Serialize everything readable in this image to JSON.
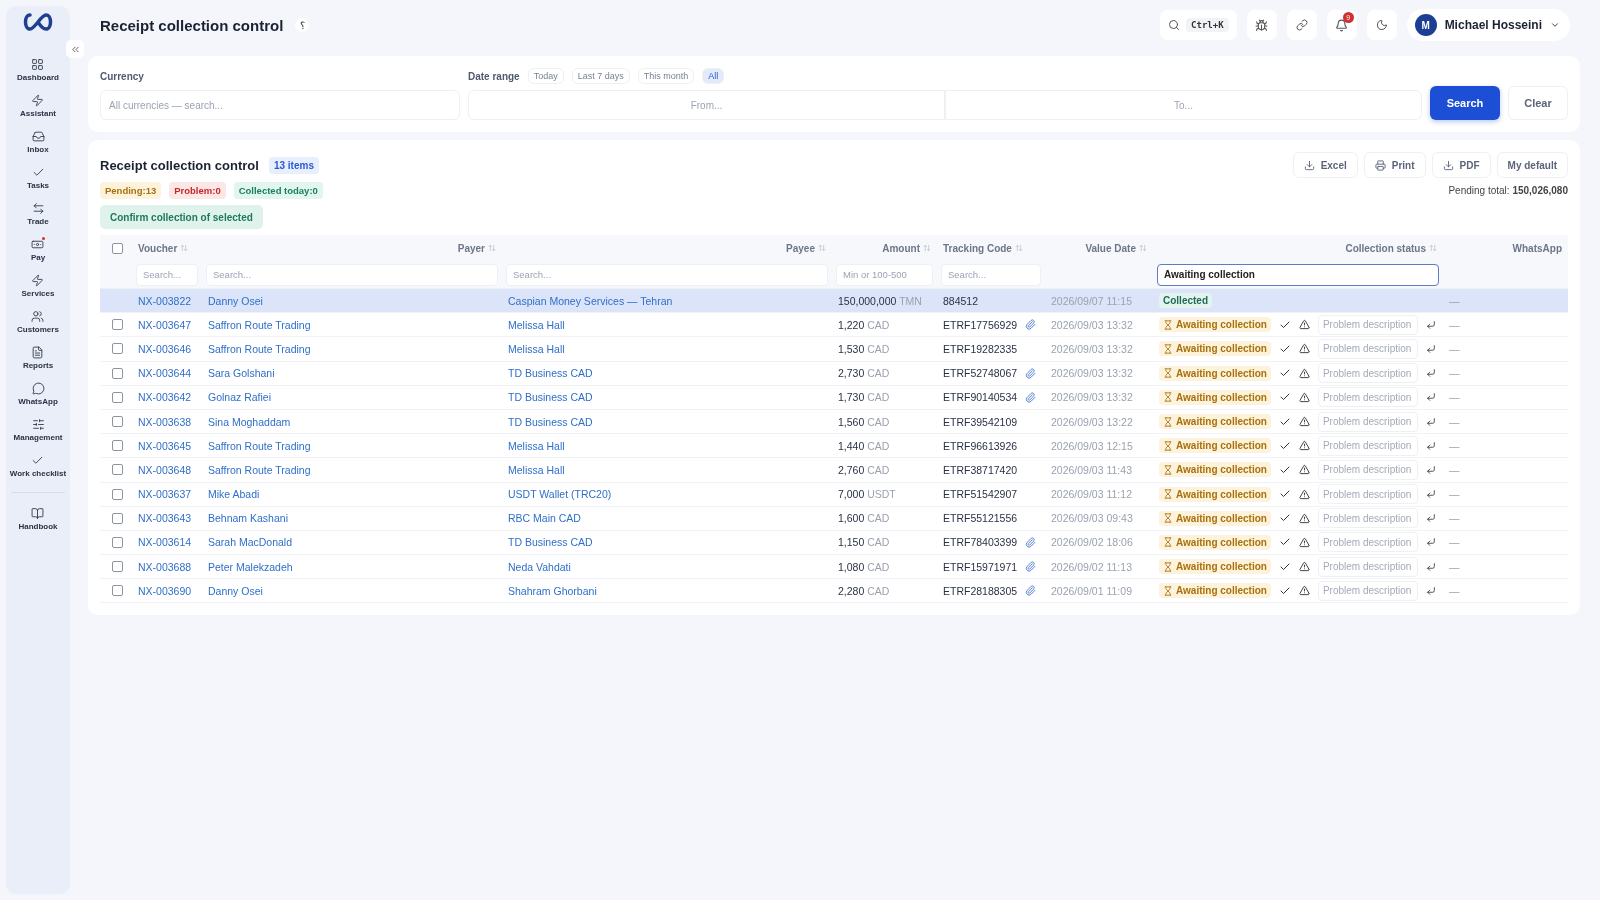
{
  "sidebar": {
    "items": [
      {
        "label": "Dashboard",
        "notify": false
      },
      {
        "label": "Assistant",
        "notify": false
      },
      {
        "label": "Inbox",
        "notify": false
      },
      {
        "label": "Tasks",
        "notify": false
      },
      {
        "label": "Trade",
        "notify": false
      },
      {
        "label": "Pay",
        "notify": true
      },
      {
        "label": "Services",
        "notify": false
      },
      {
        "label": "Customers",
        "notify": false
      },
      {
        "label": "Reports",
        "notify": false
      },
      {
        "label": "WhatsApp",
        "notify": false
      },
      {
        "label": "Management",
        "notify": false
      },
      {
        "label": "Work checklist",
        "notify": false
      },
      {
        "label": "Handbook",
        "notify": false
      }
    ]
  },
  "header": {
    "title": "Receipt collection control",
    "title_mark": "؟",
    "shortcut": "Ctrl+K",
    "notification_count": "9",
    "user_initial": "M",
    "user_name": "Michael Hosseini"
  },
  "filters": {
    "currency": {
      "label": "Currency",
      "placeholder": "All currencies — search..."
    },
    "date_range": {
      "label": "Date range",
      "presets": [
        {
          "label": "Today",
          "selected": false
        },
        {
          "label": "Last 7 days",
          "selected": false
        },
        {
          "label": "This month",
          "selected": false
        },
        {
          "label": "All",
          "selected": true
        }
      ],
      "from_placeholder": "From...",
      "to_placeholder": "To..."
    },
    "buttons": [
      "Search",
      "Clear"
    ]
  },
  "panel": {
    "title": "Receipt collection control",
    "count": "13 items",
    "stats": [
      {
        "kind": "pending",
        "label": "Pending:13"
      },
      {
        "kind": "problem",
        "label": "Problem:0"
      },
      {
        "kind": "collected",
        "label": "Collected today:0"
      }
    ],
    "confirm_button": "Confirm collection of selected",
    "actions": [
      {
        "kind": "download",
        "label": "Excel"
      },
      {
        "kind": "print",
        "label": "Print"
      },
      {
        "kind": "download",
        "label": "PDF"
      },
      {
        "kind": "plain",
        "label": "My default"
      }
    ],
    "total_label": "Pending total:",
    "total_value": "150,026,080"
  },
  "table": {
    "select_all_checked": false,
    "columns": [
      {
        "label": "Voucher",
        "sortable": true
      },
      {
        "label": "Payer",
        "sortable": true
      },
      {
        "label": "Payee",
        "sortable": true
      },
      {
        "label": "Amount",
        "sortable": true
      },
      {
        "label": "Tracking Code",
        "sortable": true
      },
      {
        "label": "Value Date",
        "sortable": true
      },
      {
        "label": "Collection status",
        "sortable": true
      },
      {
        "label": "WhatsApp",
        "sortable": false
      }
    ],
    "filter_row": {
      "voucher": {
        "placeholder": "Search..."
      },
      "payer": {
        "placeholder": "Search..."
      },
      "payee": {
        "placeholder": "Search..."
      },
      "amount": {
        "placeholder": "Min or 100-500"
      },
      "tracking": {
        "placeholder": "Search..."
      },
      "status": {
        "value": "Awaiting collection"
      }
    },
    "rows": [
      {
        "selected": true,
        "voucher": "NX-003822",
        "payer": "Danny Osei",
        "payee": "Caspian Money Services — Tehran",
        "amount": "150,000,000",
        "currency": "TMN",
        "tracking": "884512",
        "attachment": false,
        "date": "2026/09/07 11:15",
        "status": {
          "kind": "collected",
          "label": "Collected"
        },
        "whatsapp": "—"
      },
      {
        "selected": false,
        "checked": false,
        "voucher": "NX-003647",
        "payer": "Saffron Route Trading",
        "payee": "Melissa Hall",
        "amount": "1,220",
        "currency": "CAD",
        "tracking": "ETRF17756929",
        "attachment": true,
        "date": "2026/09/03 13:32",
        "status": {
          "kind": "awaiting",
          "label": "Awaiting collection",
          "problem_placeholder": "Problem description"
        },
        "whatsapp": "—"
      },
      {
        "selected": false,
        "checked": false,
        "voucher": "NX-003646",
        "payer": "Saffron Route Trading",
        "payee": "Melissa Hall",
        "amount": "1,530",
        "currency": "CAD",
        "tracking": "ETRF19282335",
        "attachment": false,
        "date": "2026/09/03 13:32",
        "status": {
          "kind": "awaiting",
          "label": "Awaiting collection",
          "problem_placeholder": "Problem description"
        },
        "whatsapp": "—"
      },
      {
        "selected": false,
        "checked": false,
        "voucher": "NX-003644",
        "payer": "Sara Golshani",
        "payee": "TD Business CAD",
        "amount": "2,730",
        "currency": "CAD",
        "tracking": "ETRF52748067",
        "attachment": true,
        "date": "2026/09/03 13:32",
        "status": {
          "kind": "awaiting",
          "label": "Awaiting collection",
          "problem_placeholder": "Problem description"
        },
        "whatsapp": "—"
      },
      {
        "selected": false,
        "checked": false,
        "voucher": "NX-003642",
        "payer": "Golnaz Rafiei",
        "payee": "TD Business CAD",
        "amount": "1,730",
        "currency": "CAD",
        "tracking": "ETRF90140534",
        "attachment": true,
        "date": "2026/09/03 13:32",
        "status": {
          "kind": "awaiting",
          "label": "Awaiting collection",
          "problem_placeholder": "Problem description"
        },
        "whatsapp": "—"
      },
      {
        "selected": false,
        "checked": false,
        "voucher": "NX-003638",
        "payer": "Sina Moghaddam",
        "payee": "TD Business CAD",
        "amount": "1,560",
        "currency": "CAD",
        "tracking": "ETRF39542109",
        "attachment": false,
        "date": "2026/09/03 13:22",
        "status": {
          "kind": "awaiting",
          "label": "Awaiting collection",
          "problem_placeholder": "Problem description"
        },
        "whatsapp": "—"
      },
      {
        "selected": false,
        "checked": false,
        "voucher": "NX-003645",
        "payer": "Saffron Route Trading",
        "payee": "Melissa Hall",
        "amount": "1,440",
        "currency": "CAD",
        "tracking": "ETRF96613926",
        "attachment": false,
        "date": "2026/09/03 12:15",
        "status": {
          "kind": "awaiting",
          "label": "Awaiting collection",
          "problem_placeholder": "Problem description"
        },
        "whatsapp": "—"
      },
      {
        "selected": false,
        "checked": false,
        "voucher": "NX-003648",
        "payer": "Saffron Route Trading",
        "payee": "Melissa Hall",
        "amount": "2,760",
        "currency": "CAD",
        "tracking": "ETRF38717420",
        "attachment": false,
        "date": "2026/09/03 11:43",
        "status": {
          "kind": "awaiting",
          "label": "Awaiting collection",
          "problem_placeholder": "Problem description"
        },
        "whatsapp": "—"
      },
      {
        "selected": false,
        "checked": false,
        "voucher": "NX-003637",
        "payer": "Mike Abadi",
        "payee": "USDT Wallet (TRC20)",
        "amount": "7,000",
        "currency": "USDT",
        "tracking": "ETRF51542907",
        "attachment": false,
        "date": "2026/09/03 11:12",
        "status": {
          "kind": "awaiting",
          "label": "Awaiting collection",
          "problem_placeholder": "Problem description"
        },
        "whatsapp": "—"
      },
      {
        "selected": false,
        "checked": false,
        "voucher": "NX-003643",
        "payer": "Behnam Kashani",
        "payee": "RBC Main CAD",
        "amount": "1,600",
        "currency": "CAD",
        "tracking": "ETRF55121556",
        "attachment": false,
        "date": "2026/09/03 09:43",
        "status": {
          "kind": "awaiting",
          "label": "Awaiting collection",
          "problem_placeholder": "Problem description"
        },
        "whatsapp": "—"
      },
      {
        "selected": false,
        "checked": false,
        "voucher": "NX-003614",
        "payer": "Sarah MacDonald",
        "payee": "TD Business CAD",
        "amount": "1,150",
        "currency": "CAD",
        "tracking": "ETRF78403399",
        "attachment": true,
        "date": "2026/09/02 18:06",
        "status": {
          "kind": "awaiting",
          "label": "Awaiting collection",
          "problem_placeholder": "Problem description"
        },
        "whatsapp": "—"
      },
      {
        "selected": false,
        "checked": false,
        "voucher": "NX-003688",
        "payer": "Peter Malekzadeh",
        "payee": "Neda Vahdati",
        "amount": "1,080",
        "currency": "CAD",
        "tracking": "ETRF15971971",
        "attachment": true,
        "date": "2026/09/02 11:13",
        "status": {
          "kind": "awaiting",
          "label": "Awaiting collection",
          "problem_placeholder": "Problem description"
        },
        "whatsapp": "—"
      },
      {
        "selected": false,
        "checked": false,
        "voucher": "NX-003690",
        "payer": "Danny Osei",
        "payee": "Shahram Ghorbani",
        "amount": "2,280",
        "currency": "CAD",
        "tracking": "ETRF28188305",
        "attachment": true,
        "date": "2026/09/01 11:09",
        "status": {
          "kind": "awaiting",
          "label": "Awaiting collection",
          "problem_placeholder": "Problem description"
        },
        "whatsapp": "—"
      }
    ]
  }
}
